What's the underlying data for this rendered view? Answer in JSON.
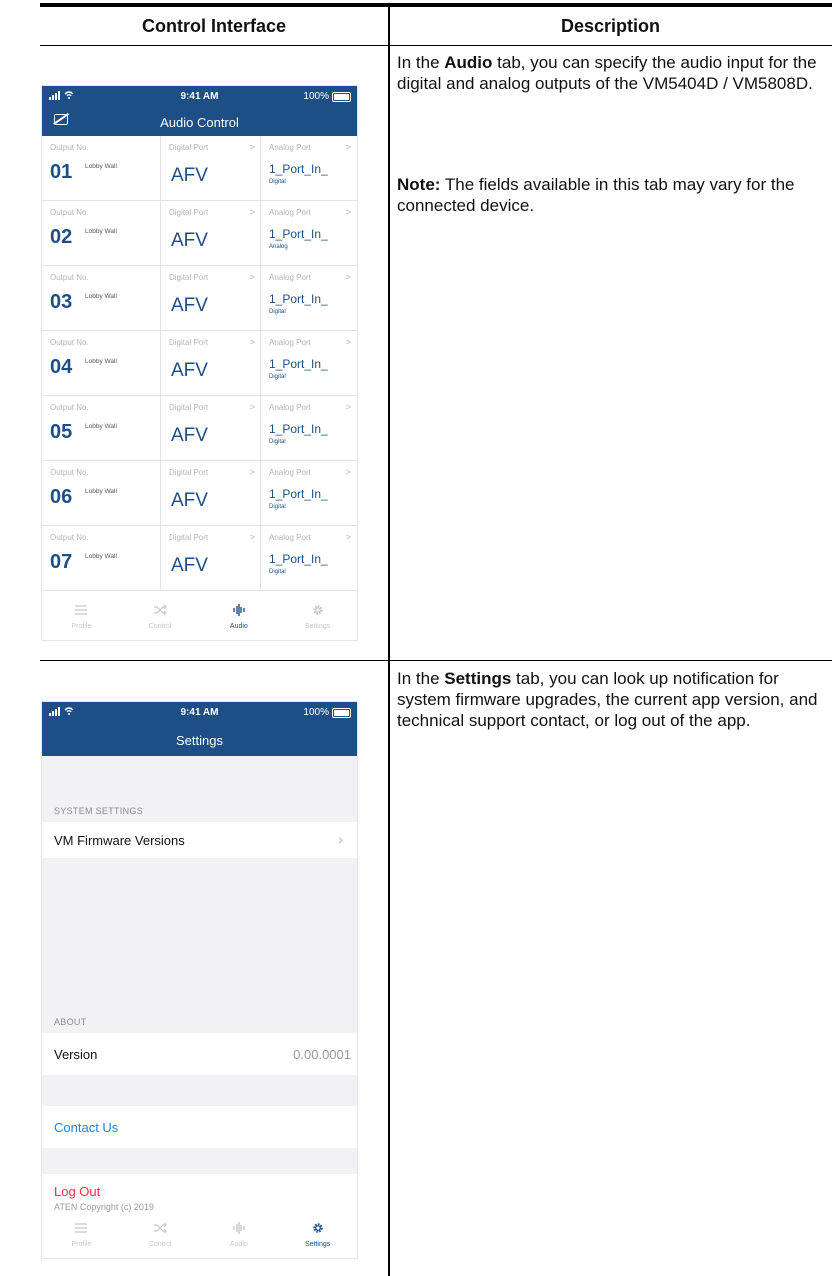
{
  "table": {
    "headers": [
      "Control Interface",
      "Description"
    ]
  },
  "audio_desc": {
    "p1_pre": "In the ",
    "p1_bold": "Audio",
    "p1_post": " tab, you can specify the audio input for the digital and analog outputs of the VM5404D / VM5808D.",
    "note_bold": "Note:",
    "note_text": " The fields available in this tab may vary for the connected device."
  },
  "settings_desc": {
    "p1_pre": "In the ",
    "p1_bold": "Settings",
    "p1_post": " tab, you can look up notification for system firmware upgrades, the current app version, and technical support contact, or log out of the app."
  },
  "status_bar": {
    "time": "9:41 AM",
    "battery": "100%"
  },
  "audio_screen": {
    "title": "Audio Control",
    "col_labels": [
      "Output No.",
      "Digital Port",
      "Analog Port"
    ],
    "chevron": ">",
    "rows": [
      {
        "no": "01",
        "name": "Lobby Wall",
        "digital": "AFV",
        "analog": "1_Port_In_",
        "mode": "Digital"
      },
      {
        "no": "02",
        "name": "Lobby Wall",
        "digital": "AFV",
        "analog": "1_Port_In_",
        "mode": "Analog"
      },
      {
        "no": "03",
        "name": "Lobby Wall",
        "digital": "AFV",
        "analog": "1_Port_In_",
        "mode": "Digital"
      },
      {
        "no": "04",
        "name": "Lobby Wall",
        "digital": "AFV",
        "analog": "1_Port_In_",
        "mode": "Digital"
      },
      {
        "no": "05",
        "name": "Lobby Wall",
        "digital": "AFV",
        "analog": "1_Port_In_",
        "mode": "Digital"
      },
      {
        "no": "06",
        "name": "Lobby Wall",
        "digital": "AFV",
        "analog": "1_Port_In_",
        "mode": "Digital"
      },
      {
        "no": "07",
        "name": "Lobby Wall",
        "digital": "AFV",
        "analog": "1_Port_In_",
        "mode": "Digital"
      }
    ]
  },
  "tabs": [
    {
      "label": "Profile",
      "icon": "list-icon"
    },
    {
      "label": "Control",
      "icon": "shuffle-icon"
    },
    {
      "label": "Audio",
      "icon": "audio-wave-icon"
    },
    {
      "label": "Settings",
      "icon": "gear-icon"
    }
  ],
  "settings_screen": {
    "title": "Settings",
    "system_header": "SYSTEM SETTINGS",
    "firmware_label": "VM Firmware Versions",
    "about_header": "ABOUT",
    "version_label": "Version",
    "version_value": "0.00.0001",
    "contact_label": "Contact Us",
    "logout_label": "Log Out",
    "copyright": "ATEN Copyright (c) 2019"
  },
  "colors": {
    "brand_blue": "#1d4f86",
    "link_blue": "#2a7fd4",
    "logout_red": "#e53935"
  }
}
